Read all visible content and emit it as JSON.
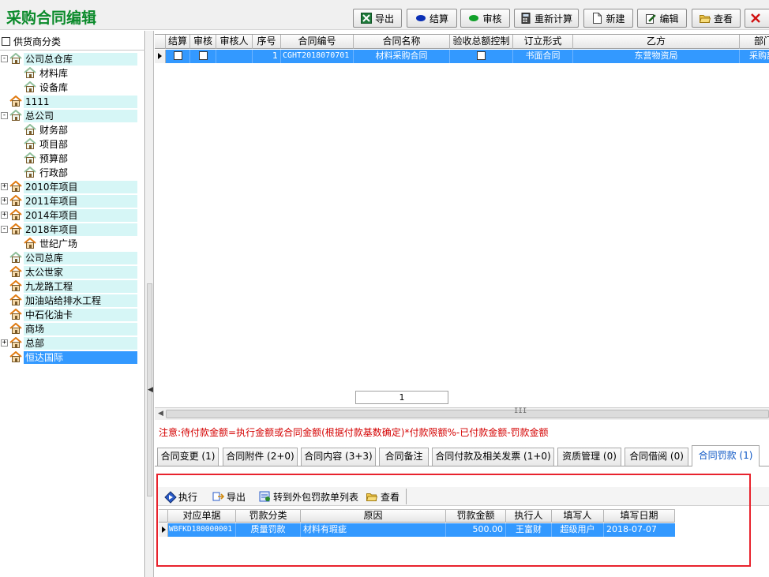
{
  "window": {
    "title": "采购合同编辑"
  },
  "toolbar": {
    "export": "导出",
    "settle": "结算",
    "audit": "审核",
    "recalc": "重新计算",
    "new": "新建",
    "edit": "编辑",
    "view": "查看"
  },
  "tree": {
    "header": "供货商分类",
    "items": [
      {
        "label": "公司总仓库"
      },
      {
        "label": "材料库"
      },
      {
        "label": "设备库"
      },
      {
        "label": "1111"
      },
      {
        "label": "总公司"
      },
      {
        "label": "财务部"
      },
      {
        "label": "项目部"
      },
      {
        "label": "预算部"
      },
      {
        "label": "行政部"
      },
      {
        "label": "2010年项目"
      },
      {
        "label": "2011年项目"
      },
      {
        "label": "2014年项目"
      },
      {
        "label": "2018年项目"
      },
      {
        "label": "世纪广场"
      },
      {
        "label": "公司总库"
      },
      {
        "label": "太公世家"
      },
      {
        "label": "九龙路工程"
      },
      {
        "label": "加油站给排水工程"
      },
      {
        "label": "中石化油卡"
      },
      {
        "label": "商场"
      },
      {
        "label": "总部"
      },
      {
        "label": "恒达国际"
      }
    ]
  },
  "contracts": {
    "columns": [
      "结算",
      "审核",
      "审核人",
      "序号",
      "合同编号",
      "合同名称",
      "验收总额控制",
      "订立形式",
      "乙方",
      "部门"
    ],
    "rows": [
      {
        "seq": "1",
        "code": "CGHT2018070701",
        "name": "材料采购合同",
        "form": "书面合同",
        "party_b": "东营物资局",
        "dept": "采购部"
      }
    ],
    "pager": "1"
  },
  "note": "注意:待付款金额=执行金额或合同金额(根据付款基数确定)*付款限额%-已付款金额-罚款金额",
  "tabs": [
    "合同变更 (1)",
    "合同附件 (2+0)",
    "合同内容 (3+3)",
    "合同备注",
    "合同付款及相关发票 (1+0)",
    "资质管理 (0)",
    "合同借阅 (0)",
    "合同罚款 (1)"
  ],
  "penalty_toolbar": {
    "execute": "执行",
    "export": "导出",
    "transfer": "转到外包罚款单列表",
    "view": "查看"
  },
  "penalties": {
    "columns": [
      "对应单据",
      "罚款分类",
      "原因",
      "罚款金额",
      "执行人",
      "填写人",
      "填写日期"
    ],
    "rows": [
      {
        "doc": "WBFKD180000001",
        "category": "质量罚款",
        "reason": "材料有瑕疵",
        "amount": "500.00",
        "executor": "王富财",
        "writer": "超级用户",
        "date": "2018-07-07"
      }
    ]
  },
  "colors": {
    "accent": "#3399ff",
    "title": "#0a8a2a",
    "note": "#d40000",
    "highlight": "#e8232d"
  }
}
